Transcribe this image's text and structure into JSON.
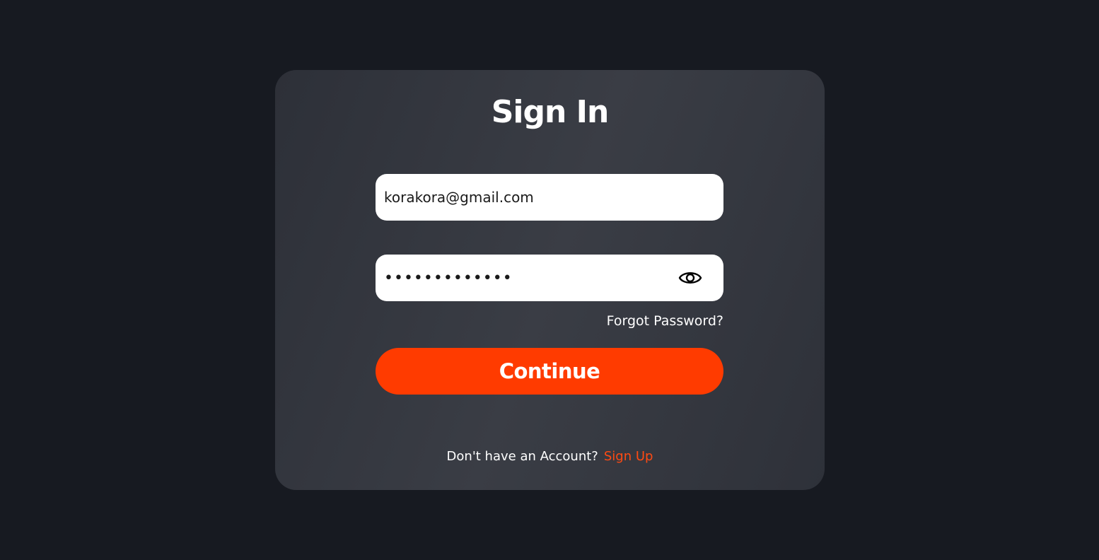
{
  "signin": {
    "title": "Sign In",
    "email": {
      "value": "korakora@gmail.com"
    },
    "password": {
      "value": "•••••••••••••",
      "icon": "eye-icon"
    },
    "forgot_password": "Forgot Password?",
    "continue_label": "Continue",
    "footer": {
      "prompt": "Don't have an Account?",
      "signup_label": "Sign Up"
    }
  },
  "colors": {
    "background": "#171a21",
    "card": "#34373f",
    "accent": "#ff3b00",
    "input_bg": "#ffffff"
  }
}
